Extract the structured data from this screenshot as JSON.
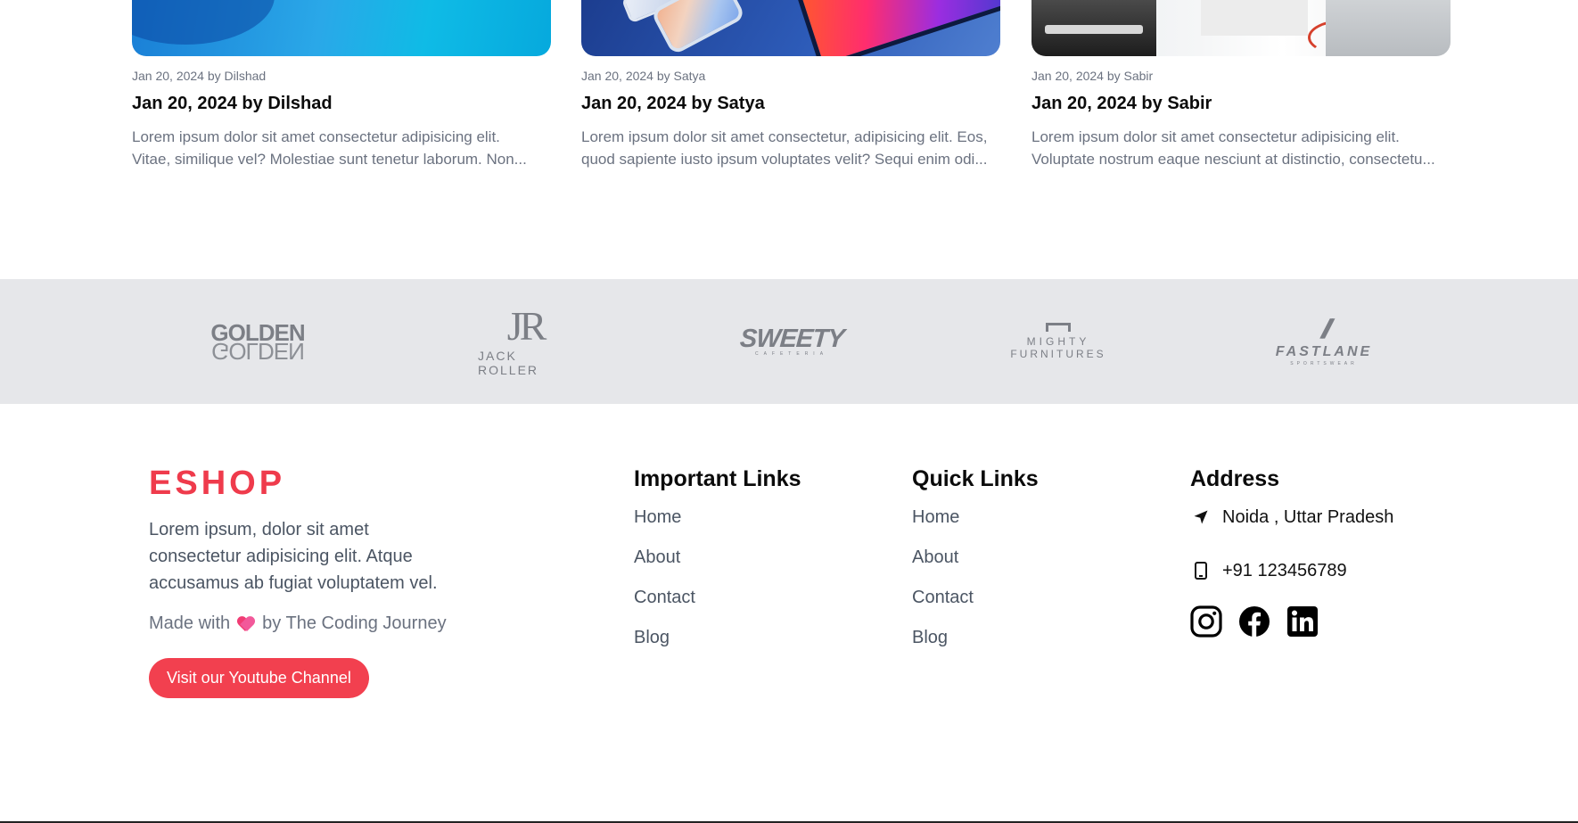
{
  "blog": {
    "posts": [
      {
        "meta": "Jan 20, 2024 by Dilshad",
        "title": "Jan 20, 2024 by Dilshad",
        "line1": "Lorem ipsum dolor sit amet consectetur adipisicing elit.",
        "line2": "Vitae, similique vel? Molestiae sunt tenetur laborum. Non..."
      },
      {
        "meta": "Jan 20, 2024 by Satya",
        "title": "Jan 20, 2024 by Satya",
        "line1": "Lorem ipsum dolor sit amet consectetur, adipisicing elit. Eos,",
        "line2": "quod sapiente iusto ipsum voluptates velit? Sequi enim odi..."
      },
      {
        "meta": "Jan 20, 2024 by Sabir",
        "title": "Jan 20, 2024 by Sabir",
        "line1": "Lorem ipsum dolor sit amet consectetur adipisicing elit.",
        "line2": "Voluptate nostrum eaque nesciunt at distinctio, consectetu..."
      }
    ]
  },
  "brands": {
    "golden": {
      "top": "GOLDEN",
      "bottom": "GOLDEN"
    },
    "jack_roller": {
      "mark": "JR",
      "name": "JACK ROLLER"
    },
    "sweety": {
      "name": "SWEETY",
      "sub": "CAFETERIA"
    },
    "mighty": {
      "line1": "MIGHTY",
      "line2": "FURNITURES"
    },
    "fastlane": {
      "mark": "//",
      "name": "FASTLANE",
      "sub": "SPORTSWEAR"
    }
  },
  "footer": {
    "brand": "ESHOP",
    "description": "Lorem ipsum, dolor sit amet consectetur adipisicing elit. Atque accusamus ab fugiat voluptatem vel.",
    "made_prefix": "Made with",
    "made_suffix": "by The Coding Journey",
    "cta_label": "Visit our Youtube Channel",
    "important_links": {
      "heading": "Important Links",
      "items": [
        "Home",
        "About",
        "Contact",
        "Blog"
      ]
    },
    "quick_links": {
      "heading": "Quick Links",
      "items": [
        "Home",
        "About",
        "Contact",
        "Blog"
      ]
    },
    "address": {
      "heading": "Address",
      "location": "Noida , Uttar Pradesh",
      "phone": "+91 123456789"
    },
    "socials": [
      "instagram-icon",
      "facebook-icon",
      "linkedin-icon"
    ]
  },
  "colors": {
    "brand_red": "#ef3b4c",
    "button_red": "#f2404f",
    "brand_strip_bg": "#e6e7ea",
    "muted_text": "#6b7280"
  }
}
